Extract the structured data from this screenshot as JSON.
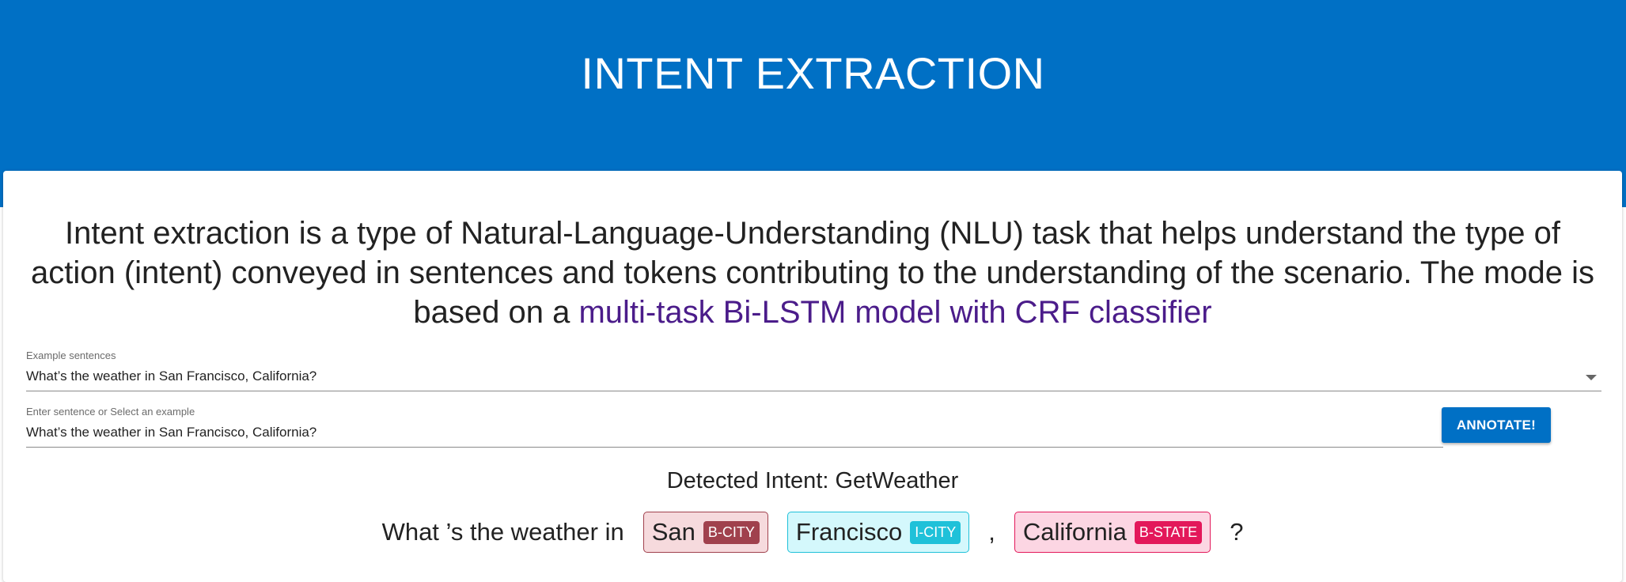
{
  "header": {
    "title": "INTENT EXTRACTION"
  },
  "intro": {
    "text": "Intent extraction is a type of Natural-Language-Understanding (NLU) task that helps understand the type of action (intent) conveyed in sentences and tokens contributing to the understanding of the scenario. The mode is based on a ",
    "link_text": "multi-task Bi-LSTM model with CRF classifier"
  },
  "example_select": {
    "label": "Example sentences",
    "value": "What’s the weather in San Francisco, California?"
  },
  "sentence_input": {
    "label": "Enter sentence or Select an example",
    "value": "What’s the weather in San Francisco, California?"
  },
  "annotate_button": {
    "label": "ANNOTATE!"
  },
  "result": {
    "detected_intent": "Detected Intent: GetWeather",
    "tokens": [
      {
        "text": "What ’s the weather in"
      },
      {
        "text": "San",
        "tag": "B-CITY",
        "tag_color": "#a0414d",
        "bg": "#f6dadd",
        "border": "#a0414d"
      },
      {
        "text": "Francisco",
        "tag": "I-CITY",
        "tag_color": "#1fc1d9",
        "bg": "#d4f8fc",
        "border": "#1fc1d9"
      },
      {
        "text": ","
      },
      {
        "text": "California",
        "tag": "B-STATE",
        "tag_color": "#e3185a",
        "bg": "#fcd6e3",
        "border": "#e3185a"
      },
      {
        "text": "?"
      }
    ]
  },
  "colors": {
    "brand": "#0070c5",
    "link": "#4b1c8a"
  }
}
